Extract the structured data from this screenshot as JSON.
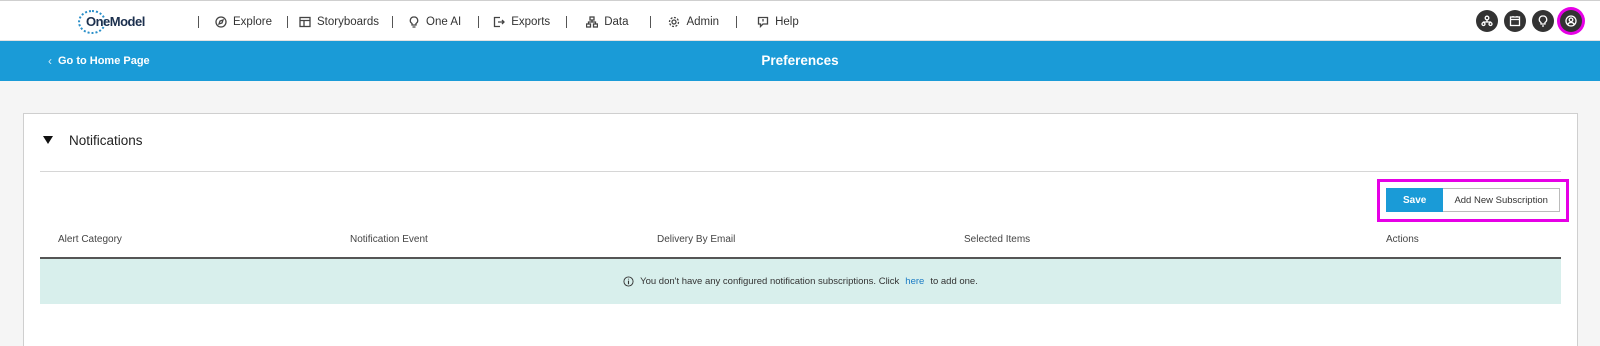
{
  "app": {
    "logo_text": "OneModel"
  },
  "nav": {
    "items": [
      {
        "label": "Explore",
        "icon": "compass-icon"
      },
      {
        "label": "Storyboards",
        "icon": "storyboard-icon"
      },
      {
        "label": "One AI",
        "icon": "lightbulb-icon"
      },
      {
        "label": "Exports",
        "icon": "export-icon"
      },
      {
        "label": "Data",
        "icon": "data-tree-icon"
      },
      {
        "label": "Admin",
        "icon": "gear-icon"
      },
      {
        "label": "Help",
        "icon": "help-chat-icon"
      }
    ],
    "right_icons": [
      "org-chart-icon",
      "calendar-icon",
      "lightbulb-pin-icon",
      "user-profile-icon"
    ]
  },
  "header_bar": {
    "back_label": "Go to Home Page",
    "title": "Preferences",
    "color": "#1a9bd7"
  },
  "section": {
    "title": "Notifications",
    "save_label": "Save",
    "add_label": "Add New Subscription",
    "columns": [
      "Alert Category",
      "Notification Event",
      "Delivery By Email",
      "Selected Items",
      "Actions"
    ],
    "empty_before": "You don't have any configured notification subscriptions. Click",
    "empty_link": "here",
    "empty_after": "to add one."
  },
  "colors": {
    "highlight": "#e600e6",
    "empty_row_bg": "#d8efec"
  }
}
